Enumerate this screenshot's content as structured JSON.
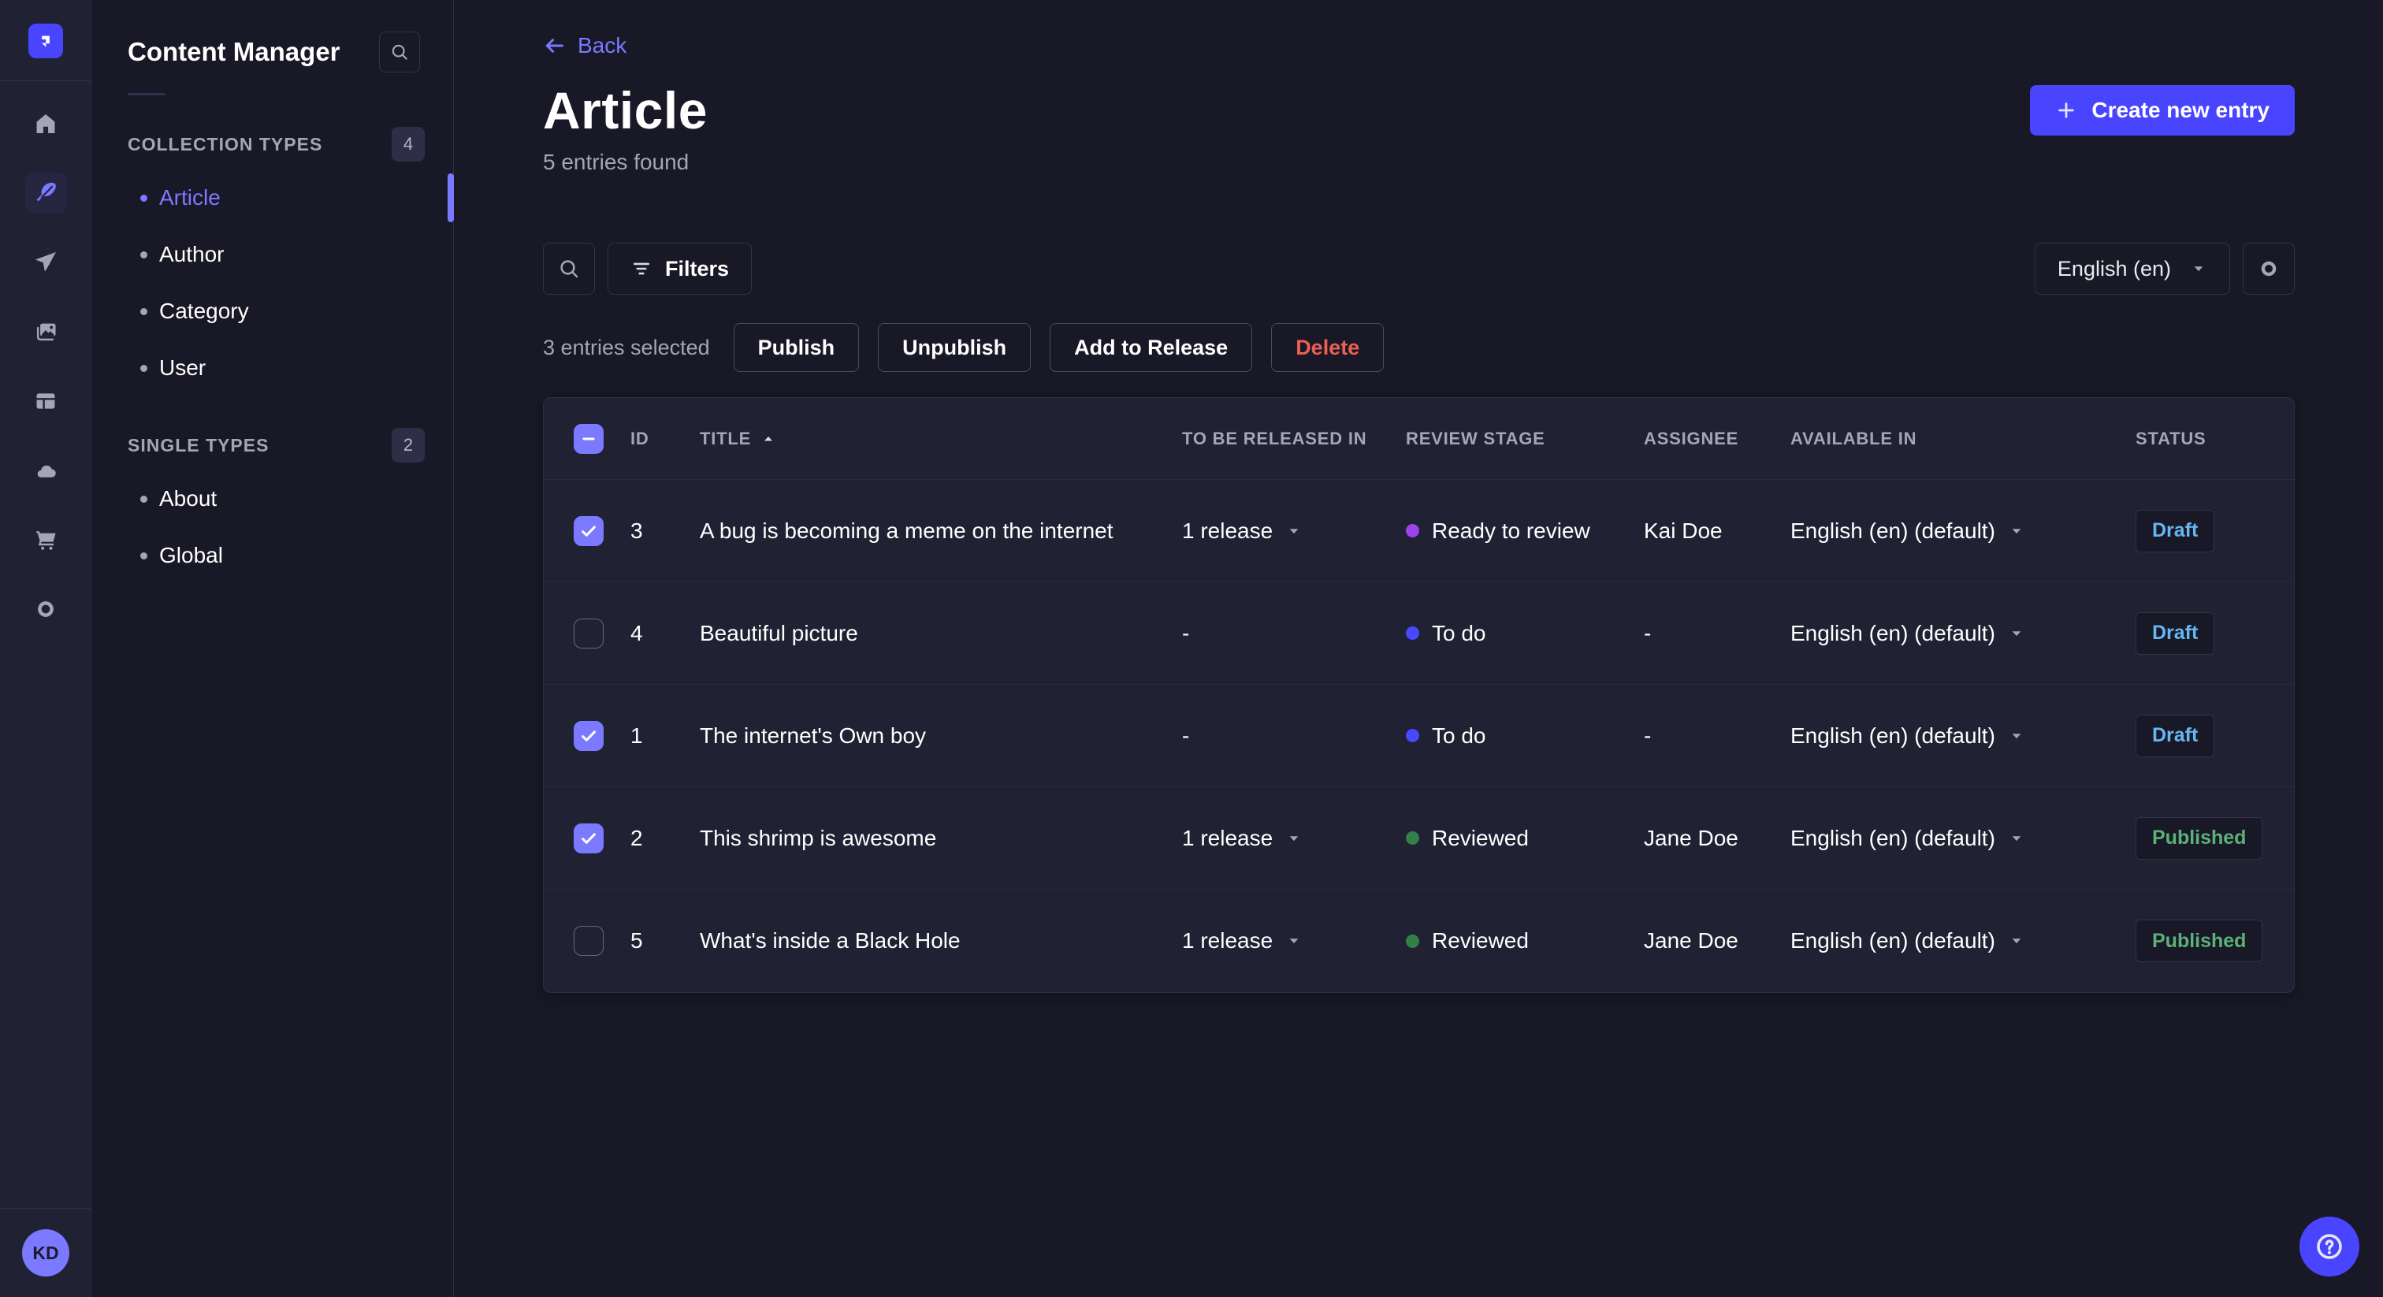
{
  "colors": {
    "brand": "#4945ff",
    "accent": "#7b79ff",
    "draft": "#66b7f1",
    "published": "#5cb176",
    "danger": "#ee5e52"
  },
  "rail": {
    "icon_names": [
      "strapi-logo",
      "home",
      "content-manager",
      "releases",
      "media-library",
      "content-type-builder",
      "cloud",
      "marketplace",
      "settings"
    ],
    "avatar_initials": "KD"
  },
  "sidebar": {
    "title": "Content Manager",
    "sections": [
      {
        "label": "COLLECTION TYPES",
        "count": "4",
        "items": [
          {
            "label": "Article",
            "active": true
          },
          {
            "label": "Author"
          },
          {
            "label": "Category"
          },
          {
            "label": "User"
          }
        ]
      },
      {
        "label": "SINGLE TYPES",
        "count": "2",
        "items": [
          {
            "label": "About"
          },
          {
            "label": "Global"
          }
        ]
      }
    ]
  },
  "header": {
    "back_label": "Back",
    "title": "Article",
    "subtitle": "5 entries found",
    "create_button": "Create new entry"
  },
  "toolbar": {
    "filters_label": "Filters",
    "locale_selected": "English (en)"
  },
  "selection": {
    "label": "3 entries selected",
    "actions": [
      {
        "label": "Publish"
      },
      {
        "label": "Unpublish"
      },
      {
        "label": "Add to Release"
      },
      {
        "label": "Delete",
        "danger": true
      }
    ]
  },
  "table": {
    "columns": [
      "ID",
      "TITLE",
      "TO BE RELEASED IN",
      "REVIEW STAGE",
      "ASSIGNEE",
      "AVAILABLE IN",
      "STATUS"
    ],
    "sort": {
      "column": "TITLE",
      "direction": "asc"
    },
    "rows": [
      {
        "checked": true,
        "id": "3",
        "title": "A bug is becoming a meme on the internet",
        "to_be_released_in": "1 release",
        "review_stage": "Ready to review",
        "review_stage_color": "#9d43eb",
        "assignee": "Kai Doe",
        "available_in": "English (en) (default)",
        "status": "Draft"
      },
      {
        "checked": false,
        "id": "4",
        "title": "Beautiful picture",
        "to_be_released_in": "-",
        "review_stage": "To do",
        "review_stage_color": "#4549ff",
        "assignee": "-",
        "available_in": "English (en) (default)",
        "status": "Draft"
      },
      {
        "checked": true,
        "id": "1",
        "title": "The internet's Own boy",
        "to_be_released_in": "-",
        "review_stage": "To do",
        "review_stage_color": "#4549ff",
        "assignee": "-",
        "available_in": "English (en) (default)",
        "status": "Draft"
      },
      {
        "checked": true,
        "id": "2",
        "title": "This shrimp is awesome",
        "to_be_released_in": "1 release",
        "review_stage": "Reviewed",
        "review_stage_color": "#328048",
        "assignee": "Jane Doe",
        "available_in": "English (en) (default)",
        "status": "Published"
      },
      {
        "checked": false,
        "id": "5",
        "title": "What's inside a Black Hole",
        "to_be_released_in": "1 release",
        "review_stage": "Reviewed",
        "review_stage_color": "#328048",
        "assignee": "Jane Doe",
        "available_in": "English (en) (default)",
        "status": "Published"
      }
    ]
  }
}
